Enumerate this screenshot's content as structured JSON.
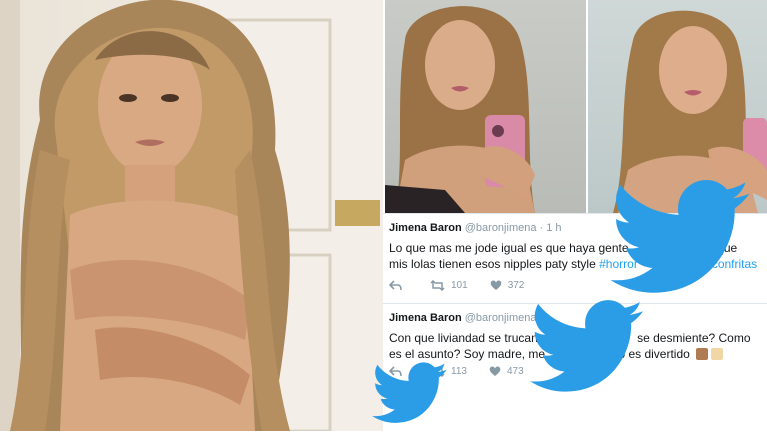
{
  "tweet_1": {
    "name": "Jimena Baron",
    "handle": "@baronjimena",
    "time": "· 1 h",
    "text_a": "Lo que mas me jode igual es que haya gente",
    "text_b": "que",
    "text_c": "mis lolas tienen esos nipples paty style",
    "hashtag_1": "#horror",
    "hashtag_2": "confritas",
    "retweets": "101",
    "likes": "372"
  },
  "tweet_2": {
    "name": "Jimena Baron",
    "handle": "@baronjimena",
    "text_a": "Con que liviandad se trucan",
    "text_b": "mi",
    "text_c": "se desmiente? Como",
    "text_d": "es el asunto? Soy madre, me",
    "text_e": "o es divertido",
    "retweets": "113",
    "likes": "473"
  },
  "colors": {
    "twitter_blue": "#1da1f2",
    "bird_blue": "#2b9ce6",
    "text": "#14171a",
    "muted": "#8899a6"
  },
  "icons": [
    "reply-icon",
    "retweet-icon",
    "like-icon",
    "twitter-bird-icon"
  ]
}
